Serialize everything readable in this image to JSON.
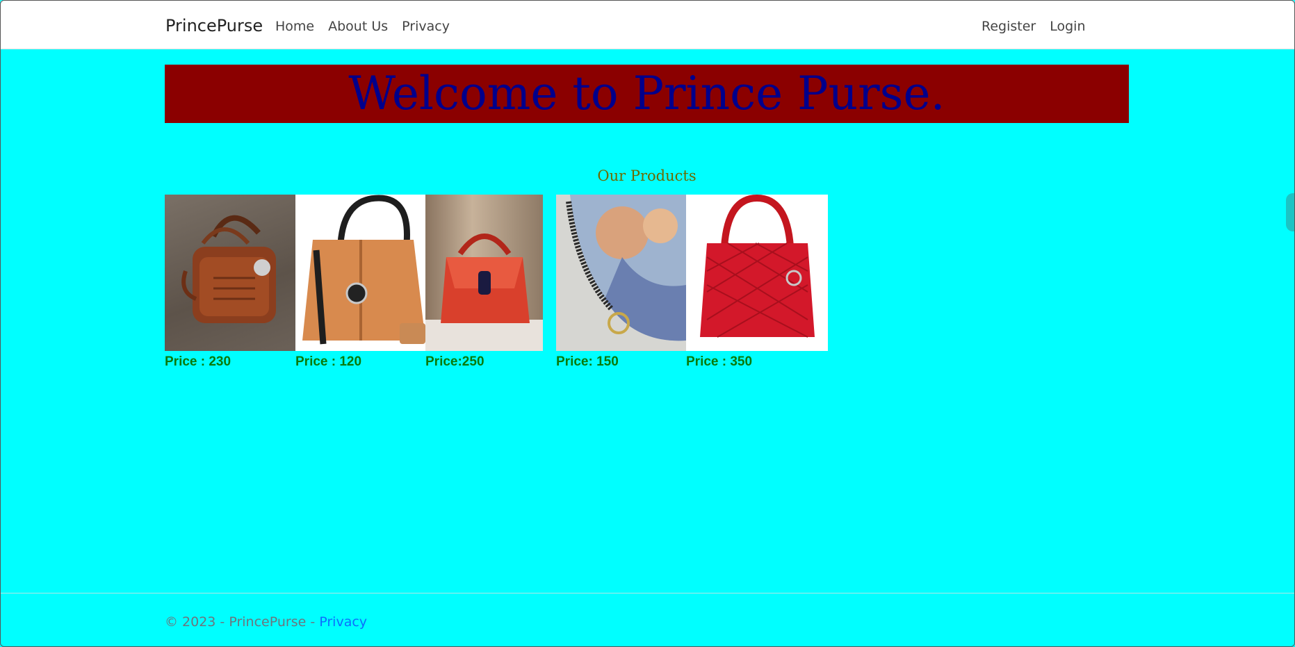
{
  "nav": {
    "brand": "PrincePurse",
    "links": [
      "Home",
      "About Us",
      "Privacy"
    ],
    "auth": [
      "Register",
      "Login"
    ]
  },
  "banner": {
    "title": "Welcome to Prince Purse."
  },
  "products": {
    "heading": "Our Products",
    "items": [
      {
        "price": "Price : 230",
        "icon": "brown-leather-handbag"
      },
      {
        "price": "Price : 120",
        "icon": "tan-tote-bag"
      },
      {
        "price": "Price:250",
        "icon": "red-top-handle-bag"
      },
      {
        "price": "Price: 150",
        "icon": "photo-print-zip-pouch"
      },
      {
        "price": "Price : 350",
        "icon": "red-quilted-handbag"
      }
    ]
  },
  "footer": {
    "copyright": "© 2023 - PrincePurse - ",
    "privacy_link": "Privacy"
  },
  "colors": {
    "page_bg": "#00ffff",
    "banner_bg": "#8b0000",
    "banner_text": "#00008b",
    "price_text": "#0a7a0a"
  }
}
